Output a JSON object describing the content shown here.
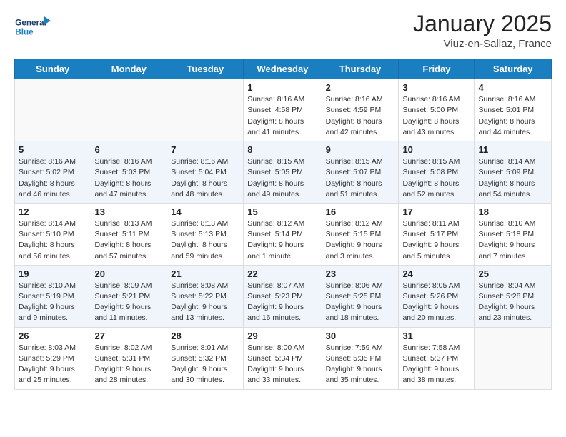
{
  "header": {
    "logo_line1": "General",
    "logo_line2": "Blue",
    "month": "January 2025",
    "location": "Viuz-en-Sallaz, France"
  },
  "weekdays": [
    "Sunday",
    "Monday",
    "Tuesday",
    "Wednesday",
    "Thursday",
    "Friday",
    "Saturday"
  ],
  "weeks": [
    [
      {
        "day": "",
        "info": ""
      },
      {
        "day": "",
        "info": ""
      },
      {
        "day": "",
        "info": ""
      },
      {
        "day": "1",
        "info": "Sunrise: 8:16 AM\nSunset: 4:58 PM\nDaylight: 8 hours\nand 41 minutes."
      },
      {
        "day": "2",
        "info": "Sunrise: 8:16 AM\nSunset: 4:59 PM\nDaylight: 8 hours\nand 42 minutes."
      },
      {
        "day": "3",
        "info": "Sunrise: 8:16 AM\nSunset: 5:00 PM\nDaylight: 8 hours\nand 43 minutes."
      },
      {
        "day": "4",
        "info": "Sunrise: 8:16 AM\nSunset: 5:01 PM\nDaylight: 8 hours\nand 44 minutes."
      }
    ],
    [
      {
        "day": "5",
        "info": "Sunrise: 8:16 AM\nSunset: 5:02 PM\nDaylight: 8 hours\nand 46 minutes."
      },
      {
        "day": "6",
        "info": "Sunrise: 8:16 AM\nSunset: 5:03 PM\nDaylight: 8 hours\nand 47 minutes."
      },
      {
        "day": "7",
        "info": "Sunrise: 8:16 AM\nSunset: 5:04 PM\nDaylight: 8 hours\nand 48 minutes."
      },
      {
        "day": "8",
        "info": "Sunrise: 8:15 AM\nSunset: 5:05 PM\nDaylight: 8 hours\nand 49 minutes."
      },
      {
        "day": "9",
        "info": "Sunrise: 8:15 AM\nSunset: 5:07 PM\nDaylight: 8 hours\nand 51 minutes."
      },
      {
        "day": "10",
        "info": "Sunrise: 8:15 AM\nSunset: 5:08 PM\nDaylight: 8 hours\nand 52 minutes."
      },
      {
        "day": "11",
        "info": "Sunrise: 8:14 AM\nSunset: 5:09 PM\nDaylight: 8 hours\nand 54 minutes."
      }
    ],
    [
      {
        "day": "12",
        "info": "Sunrise: 8:14 AM\nSunset: 5:10 PM\nDaylight: 8 hours\nand 56 minutes."
      },
      {
        "day": "13",
        "info": "Sunrise: 8:13 AM\nSunset: 5:11 PM\nDaylight: 8 hours\nand 57 minutes."
      },
      {
        "day": "14",
        "info": "Sunrise: 8:13 AM\nSunset: 5:13 PM\nDaylight: 8 hours\nand 59 minutes."
      },
      {
        "day": "15",
        "info": "Sunrise: 8:12 AM\nSunset: 5:14 PM\nDaylight: 9 hours\nand 1 minute."
      },
      {
        "day": "16",
        "info": "Sunrise: 8:12 AM\nSunset: 5:15 PM\nDaylight: 9 hours\nand 3 minutes."
      },
      {
        "day": "17",
        "info": "Sunrise: 8:11 AM\nSunset: 5:17 PM\nDaylight: 9 hours\nand 5 minutes."
      },
      {
        "day": "18",
        "info": "Sunrise: 8:10 AM\nSunset: 5:18 PM\nDaylight: 9 hours\nand 7 minutes."
      }
    ],
    [
      {
        "day": "19",
        "info": "Sunrise: 8:10 AM\nSunset: 5:19 PM\nDaylight: 9 hours\nand 9 minutes."
      },
      {
        "day": "20",
        "info": "Sunrise: 8:09 AM\nSunset: 5:21 PM\nDaylight: 9 hours\nand 11 minutes."
      },
      {
        "day": "21",
        "info": "Sunrise: 8:08 AM\nSunset: 5:22 PM\nDaylight: 9 hours\nand 13 minutes."
      },
      {
        "day": "22",
        "info": "Sunrise: 8:07 AM\nSunset: 5:23 PM\nDaylight: 9 hours\nand 16 minutes."
      },
      {
        "day": "23",
        "info": "Sunrise: 8:06 AM\nSunset: 5:25 PM\nDaylight: 9 hours\nand 18 minutes."
      },
      {
        "day": "24",
        "info": "Sunrise: 8:05 AM\nSunset: 5:26 PM\nDaylight: 9 hours\nand 20 minutes."
      },
      {
        "day": "25",
        "info": "Sunrise: 8:04 AM\nSunset: 5:28 PM\nDaylight: 9 hours\nand 23 minutes."
      }
    ],
    [
      {
        "day": "26",
        "info": "Sunrise: 8:03 AM\nSunset: 5:29 PM\nDaylight: 9 hours\nand 25 minutes."
      },
      {
        "day": "27",
        "info": "Sunrise: 8:02 AM\nSunset: 5:31 PM\nDaylight: 9 hours\nand 28 minutes."
      },
      {
        "day": "28",
        "info": "Sunrise: 8:01 AM\nSunset: 5:32 PM\nDaylight: 9 hours\nand 30 minutes."
      },
      {
        "day": "29",
        "info": "Sunrise: 8:00 AM\nSunset: 5:34 PM\nDaylight: 9 hours\nand 33 minutes."
      },
      {
        "day": "30",
        "info": "Sunrise: 7:59 AM\nSunset: 5:35 PM\nDaylight: 9 hours\nand 35 minutes."
      },
      {
        "day": "31",
        "info": "Sunrise: 7:58 AM\nSunset: 5:37 PM\nDaylight: 9 hours\nand 38 minutes."
      },
      {
        "day": "",
        "info": ""
      }
    ]
  ]
}
